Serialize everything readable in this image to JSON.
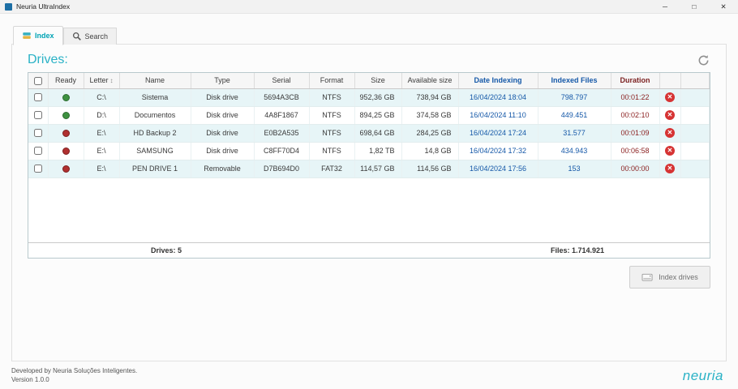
{
  "window": {
    "title": "Neuria UltraIndex",
    "minimize": "─",
    "maximize": "□",
    "close": "✕"
  },
  "tabs": {
    "index": "Index",
    "search": "Search"
  },
  "drives": {
    "heading": "Drives:",
    "headers": {
      "ready": "Ready",
      "letter": "Letter",
      "name": "Name",
      "type": "Type",
      "serial": "Serial",
      "format": "Format",
      "size": "Size",
      "available": "Available size",
      "date": "Date Indexing",
      "indexed": "Indexed Files",
      "duration": "Duration"
    },
    "rows": [
      {
        "ready": "green",
        "letter": "C:\\",
        "name": "Sistema",
        "type": "Disk drive",
        "serial": "5694A3CB",
        "format": "NTFS",
        "size": "952,36 GB",
        "available": "738,94 GB",
        "date": "16/04/2024 18:04",
        "indexed": "798.797",
        "duration": "00:01:22"
      },
      {
        "ready": "green",
        "letter": "D:\\",
        "name": "Documentos",
        "type": "Disk drive",
        "serial": "4A8F1867",
        "format": "NTFS",
        "size": "894,25 GB",
        "available": "374,58 GB",
        "date": "16/04/2024 11:10",
        "indexed": "449.451",
        "duration": "00:02:10"
      },
      {
        "ready": "red",
        "letter": "E:\\",
        "name": "HD Backup 2",
        "type": "Disk drive",
        "serial": "E0B2A535",
        "format": "NTFS",
        "size": "698,64 GB",
        "available": "284,25 GB",
        "date": "16/04/2024 17:24",
        "indexed": "31.577",
        "duration": "00:01:09"
      },
      {
        "ready": "red",
        "letter": "E:\\",
        "name": "SAMSUNG",
        "type": "Disk drive",
        "serial": "C8FF70D4",
        "format": "NTFS",
        "size": "1,82 TB",
        "available": "14,8 GB",
        "date": "16/04/2024 17:32",
        "indexed": "434.943",
        "duration": "00:06:58"
      },
      {
        "ready": "red",
        "letter": "E:\\",
        "name": "PEN DRIVE 1",
        "type": "Removable",
        "serial": "D7B694D0",
        "format": "FAT32",
        "size": "114,57 GB",
        "available": "114,56 GB",
        "date": "16/04/2024 17:56",
        "indexed": "153",
        "duration": "00:00:00"
      }
    ],
    "summary": {
      "drives": "Drives: 5",
      "files": "Files: 1.714.921"
    }
  },
  "actions": {
    "index_drives": "Index drives"
  },
  "app_footer": {
    "credit": "Developed by Neuria Soluções Inteligentes.",
    "version": "Version 1.0.0",
    "logo": "neuria"
  },
  "icons": {
    "delete": "✕",
    "sort": "↕",
    "refresh": "circular-arrow",
    "search": "magnifier",
    "index_tab": "drive-stack",
    "index_button": "drive"
  },
  "colors": {
    "accent_teal": "#2ab2c6",
    "link_blue": "#1558a8",
    "duration_red": "#8a1f1f",
    "ready_green": "#3d9140",
    "ready_red": "#b03030",
    "delete_red": "#d63333",
    "alt_row": "#e7f5f7"
  }
}
